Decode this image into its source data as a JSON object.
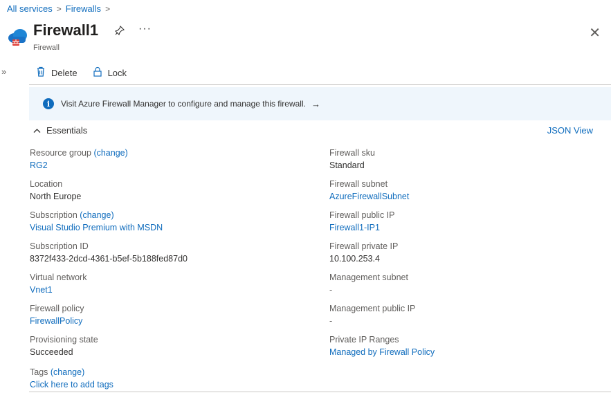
{
  "breadcrumb": {
    "items": [
      "All services",
      "Firewalls"
    ],
    "separator": ">"
  },
  "header": {
    "title": "Firewall1",
    "subtitle": "Firewall",
    "more": "···",
    "close": "✕"
  },
  "toolbar": {
    "delete_label": "Delete",
    "lock_label": "Lock"
  },
  "banner": {
    "text": "Visit Azure Firewall Manager to configure and manage this firewall.",
    "arrow": "→"
  },
  "essentials": {
    "title": "Essentials",
    "json_view": "JSON View",
    "left": [
      {
        "label": "Resource group",
        "change": "(change)",
        "value": "RG2",
        "link": true
      },
      {
        "label": "Location",
        "value": "North Europe",
        "link": false
      },
      {
        "label": "Subscription",
        "change": "(change)",
        "value": "Visual Studio Premium with MSDN",
        "link": true
      },
      {
        "label": "Subscription ID",
        "value": "8372f433-2dcd-4361-b5ef-5b188fed87d0",
        "link": false
      },
      {
        "label": "Virtual network",
        "value": "Vnet1",
        "link": true
      },
      {
        "label": "Firewall policy",
        "value": "FirewallPolicy",
        "link": true
      },
      {
        "label": "Provisioning state",
        "value": "Succeeded",
        "link": false
      }
    ],
    "right": [
      {
        "label": "Firewall sku",
        "value": "Standard",
        "link": false
      },
      {
        "label": "Firewall subnet",
        "value": "AzureFirewallSubnet",
        "link": true
      },
      {
        "label": "Firewall public IP",
        "value": "Firewall1-IP1",
        "link": true
      },
      {
        "label": "Firewall private IP",
        "value": "10.100.253.4",
        "link": false
      },
      {
        "label": "Management subnet",
        "value": "-",
        "link": false
      },
      {
        "label": "Management public IP",
        "value": "-",
        "link": false
      },
      {
        "label": "Private IP Ranges",
        "value": "Managed by Firewall Policy",
        "link": true
      }
    ],
    "tags": {
      "label": "Tags",
      "change": "(change)",
      "value": "Click here to add tags"
    }
  },
  "colors": {
    "accent": "#0f6cbd",
    "banner_bg": "#eff6fc",
    "text": "#323130",
    "muted": "#605e5c"
  }
}
